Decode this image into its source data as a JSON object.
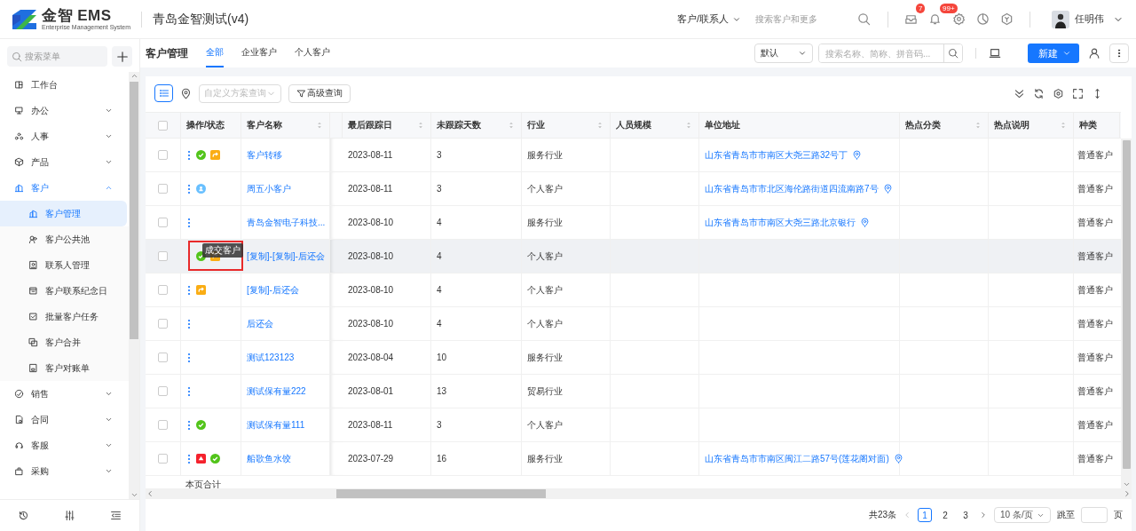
{
  "header": {
    "brand": "金智 EMS",
    "brand_subtitle": "Enterprise Management System",
    "company": "青岛金智测试(v4)",
    "search_scope": "客户/联系人",
    "search_placeholder": "搜索客户和更多",
    "message_badge": "7",
    "notification_badge": "99+",
    "user_name": "任明伟"
  },
  "sidebar": {
    "search_placeholder": "搜索菜单",
    "items": [
      {
        "label": "工作台",
        "kind": "link"
      },
      {
        "label": "办公",
        "kind": "group",
        "expanded": false
      },
      {
        "label": "人事",
        "kind": "group",
        "expanded": false
      },
      {
        "label": "产品",
        "kind": "group",
        "expanded": false
      },
      {
        "label": "客户",
        "kind": "group",
        "expanded": true,
        "children": [
          {
            "label": "客户管理",
            "selected": true
          },
          {
            "label": "客户公共池",
            "selected": false
          },
          {
            "label": "联系人管理",
            "selected": false
          },
          {
            "label": "客户联系纪念日",
            "selected": false
          },
          {
            "label": "批量客户任务",
            "selected": false
          },
          {
            "label": "客户合并",
            "selected": false
          },
          {
            "label": "客户对账单",
            "selected": false
          }
        ]
      },
      {
        "label": "销售",
        "kind": "group",
        "expanded": false
      },
      {
        "label": "合同",
        "kind": "group",
        "expanded": false
      },
      {
        "label": "客服",
        "kind": "group",
        "expanded": false
      },
      {
        "label": "采购",
        "kind": "group",
        "expanded": false
      }
    ]
  },
  "page": {
    "title": "客户管理",
    "tabs": [
      {
        "label": "全部",
        "selected": true
      },
      {
        "label": "企业客户",
        "selected": false
      },
      {
        "label": "个人客户",
        "selected": false
      }
    ],
    "sort_select": "默认",
    "search_placeholder": "搜索名称、简称、拼音码...",
    "new_button": "新建"
  },
  "toolbar": {
    "list_view_selected": true,
    "scheme_placeholder": "自定义方案查询",
    "advanced_button": "高级查询"
  },
  "table": {
    "columns": [
      {
        "label": "操作/状态",
        "sortable": false
      },
      {
        "label": "客户名称",
        "sortable": true
      },
      {
        "label": "最后跟踪日",
        "sortable": true
      },
      {
        "label": "未跟踪天数",
        "sortable": true
      },
      {
        "label": "行业",
        "sortable": true
      },
      {
        "label": "人员规模",
        "sortable": true
      },
      {
        "label": "单位地址",
        "sortable": false
      },
      {
        "label": "热点分类",
        "sortable": true
      },
      {
        "label": "热点说明",
        "sortable": true
      },
      {
        "label": "种类",
        "sortable": false
      }
    ],
    "rows": [
      {
        "checked": false,
        "hovered": false,
        "statuses": [
          {
            "kind": "deal"
          },
          {
            "kind": "transfer"
          }
        ],
        "name": "客户转移",
        "last_follow": "2023-08-11",
        "days": "3",
        "industry": "服务行业",
        "address": "山东省青岛市市南区大尧三路32号丁",
        "type": "普通客户"
      },
      {
        "checked": false,
        "hovered": false,
        "statuses": [
          {
            "kind": "person"
          }
        ],
        "name": "周五小客户",
        "last_follow": "2023-08-11",
        "days": "3",
        "industry": "个人客户",
        "address": "山东省青岛市市北区海伦路街道四流南路7号",
        "type": "普通客户"
      },
      {
        "checked": false,
        "hovered": false,
        "statuses": [],
        "name": "青岛金智电子科技...",
        "last_follow": "2023-08-10",
        "days": "4",
        "industry": "服务行业",
        "address": "山东省青岛市市南区大尧三路北京银行",
        "type": "普通客户"
      },
      {
        "checked": false,
        "hovered": true,
        "statuses": [
          {
            "kind": "deal"
          },
          {
            "kind": "transfer"
          }
        ],
        "tooltip": "成交客户",
        "marked": true,
        "name": "[复制]-[复制]-后还会",
        "last_follow": "2023-08-10",
        "days": "4",
        "industry": "个人客户",
        "type": "普通客户"
      },
      {
        "checked": false,
        "hovered": false,
        "statuses": [
          {
            "kind": "transfer"
          }
        ],
        "name": "[复制]-后还会",
        "last_follow": "2023-08-10",
        "days": "4",
        "industry": "个人客户",
        "type": "普通客户"
      },
      {
        "checked": false,
        "hovered": false,
        "statuses": [],
        "name": "后还会",
        "last_follow": "2023-08-10",
        "days": "4",
        "industry": "个人客户",
        "type": "普通客户"
      },
      {
        "checked": false,
        "hovered": false,
        "statuses": [],
        "name": "测试123123",
        "last_follow": "2023-08-04",
        "days": "10",
        "industry": "服务行业",
        "type": "普通客户"
      },
      {
        "checked": false,
        "hovered": false,
        "statuses": [],
        "name": "测试保有量222",
        "last_follow": "2023-08-01",
        "days": "13",
        "industry": "贸易行业",
        "type": "普通客户"
      },
      {
        "checked": false,
        "hovered": false,
        "statuses": [
          {
            "kind": "deal"
          }
        ],
        "name": "测试保有量111",
        "last_follow": "2023-08-11",
        "days": "3",
        "industry": "个人客户",
        "type": "普通客户"
      },
      {
        "checked": false,
        "hovered": false,
        "statuses": [
          {
            "kind": "alert"
          },
          {
            "kind": "deal"
          }
        ],
        "name": "船歌鱼水饺",
        "last_follow": "2023-07-29",
        "days": "16",
        "industry": "服务行业",
        "address": "山东省青岛市市南区闽江二路57号(莲花阁对面)",
        "type": "普通客户"
      }
    ],
    "footer_label": "本页合计",
    "select_all_checked": false
  },
  "pagination": {
    "total": "共23条",
    "pages": [
      {
        "label": "1",
        "selected": true
      },
      {
        "label": "2",
        "selected": false
      },
      {
        "label": "3",
        "selected": false
      }
    ],
    "page_size": "10 条/页",
    "jump_label": "跳至",
    "page_unit": "页"
  }
}
